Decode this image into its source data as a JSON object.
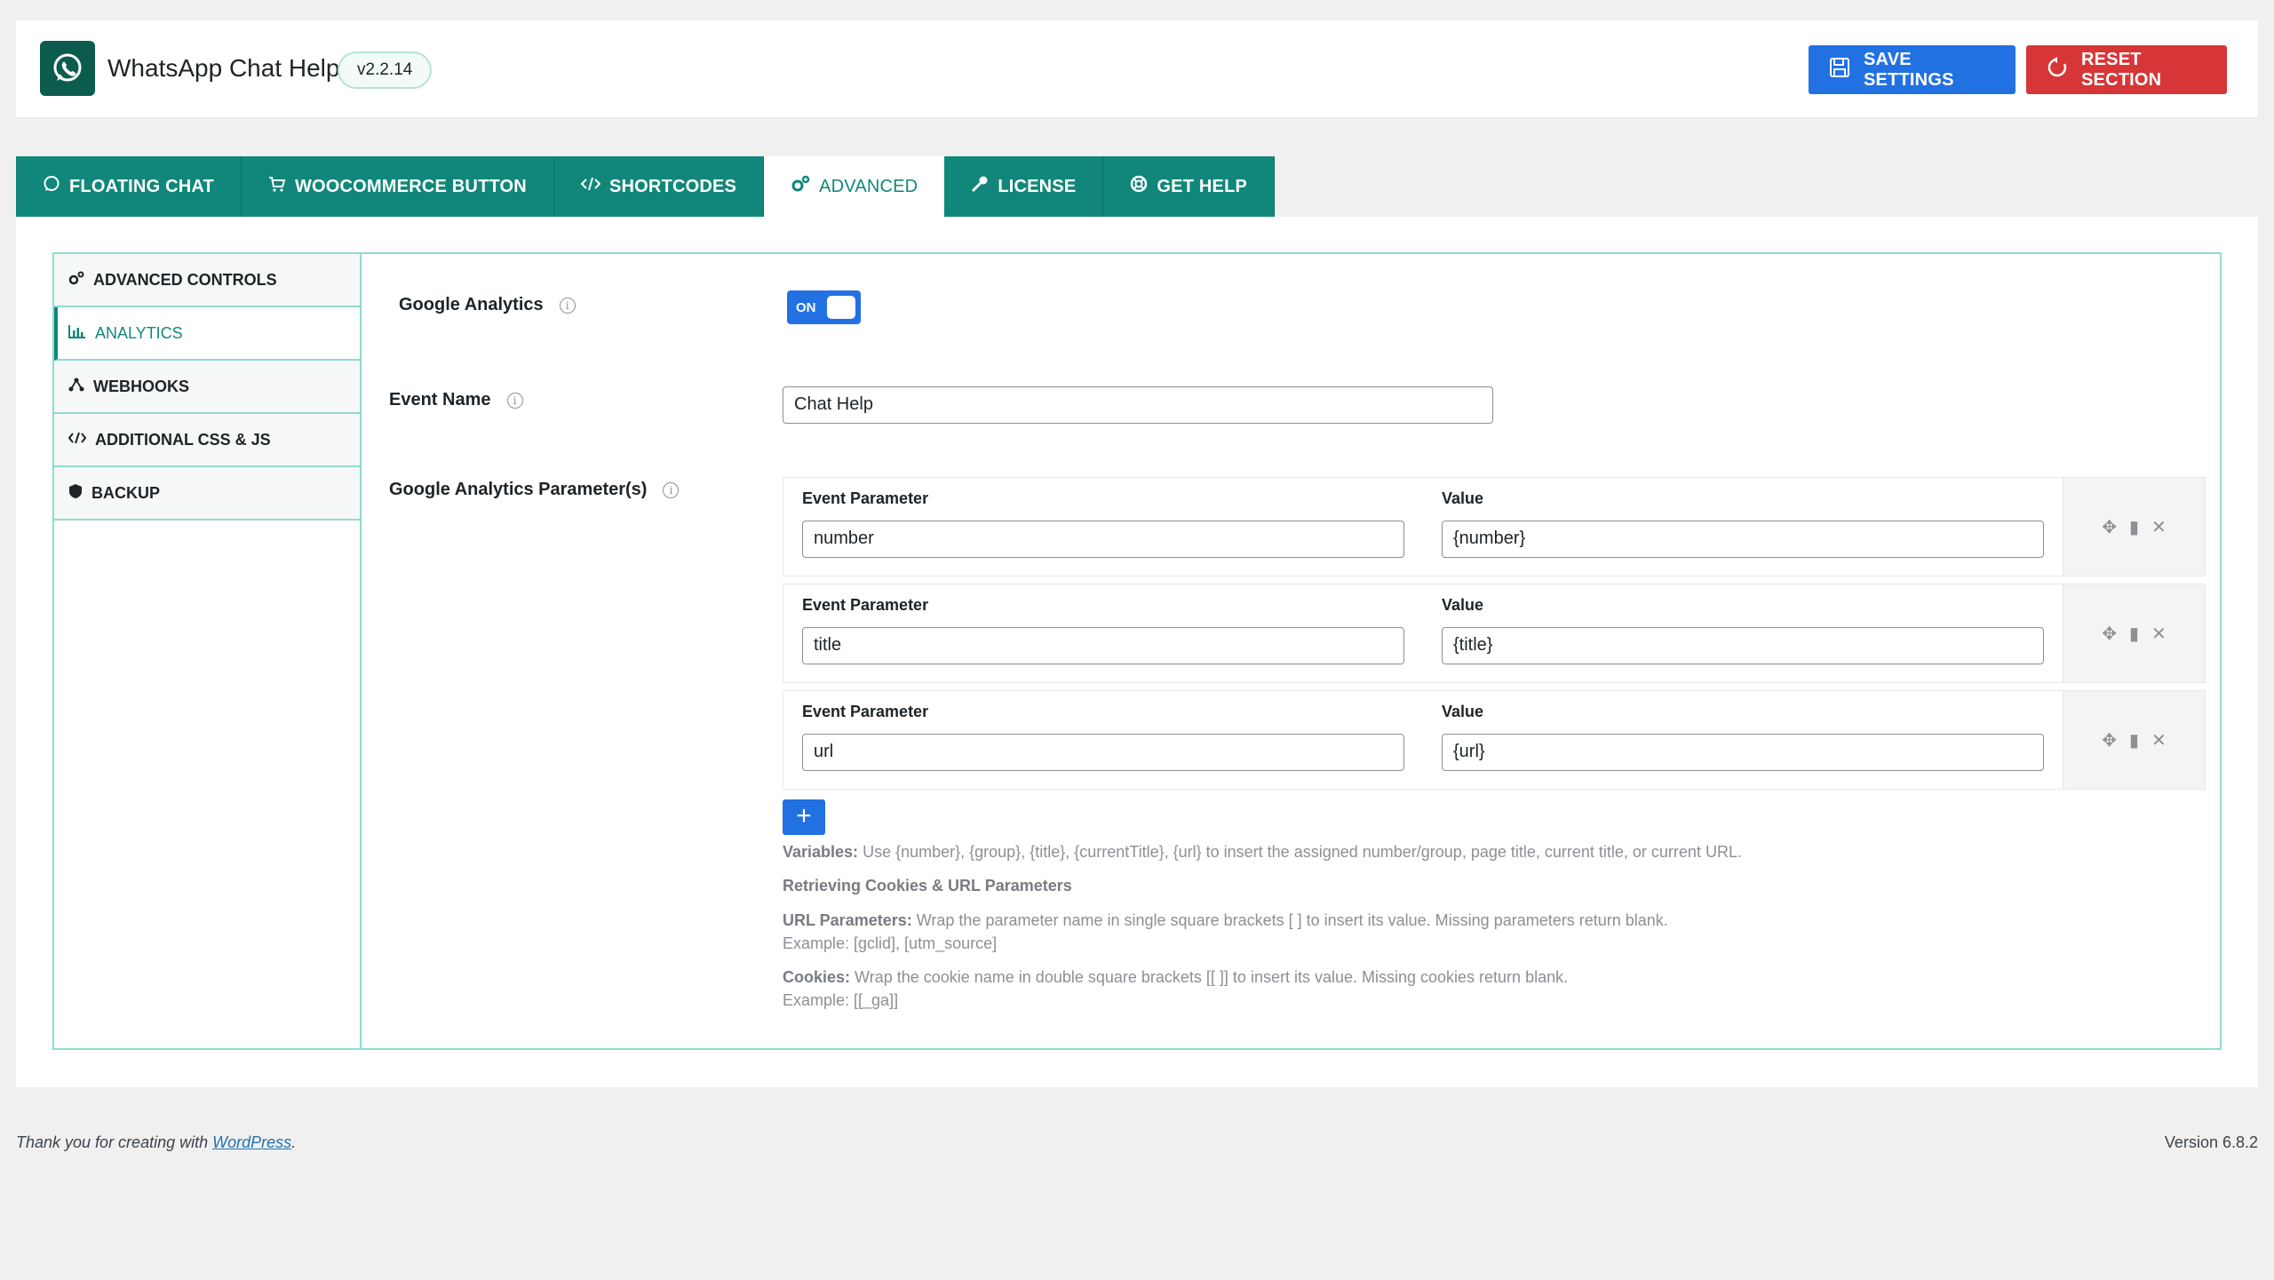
{
  "app": {
    "title": "WhatsApp Chat Help",
    "version": "v2.2.14"
  },
  "header": {
    "save_label": "SAVE SETTINGS",
    "reset_label": "RESET SECTION"
  },
  "tabs": [
    {
      "label": "FLOATING CHAT",
      "icon": "whatsapp-icon"
    },
    {
      "label": "WOOCOMMERCE BUTTON",
      "icon": "cart-icon"
    },
    {
      "label": "SHORTCODES",
      "icon": "code-icon"
    },
    {
      "label": "ADVANCED",
      "icon": "gears-icon",
      "active": true
    },
    {
      "label": "LICENSE",
      "icon": "key-icon"
    },
    {
      "label": "GET HELP",
      "icon": "lifebuoy-icon"
    }
  ],
  "sidebar": {
    "items": [
      {
        "label": "ADVANCED CONTROLS",
        "icon": "gears-icon"
      },
      {
        "label": "ANALYTICS",
        "icon": "chart-icon",
        "active": true
      },
      {
        "label": "WEBHOOKS",
        "icon": "webhook-icon"
      },
      {
        "label": "ADDITIONAL CSS & JS",
        "icon": "code-icon"
      },
      {
        "label": "BACKUP",
        "icon": "shield-icon"
      }
    ]
  },
  "fields": {
    "ga_label": "Google Analytics",
    "ga_toggle": "ON",
    "event_name_label": "Event Name",
    "event_name_value": "Chat Help",
    "params_label": "Google Analytics Parameter(s)",
    "param_header": "Event Parameter",
    "value_header": "Value",
    "params": [
      {
        "param": "number",
        "value": "{number}"
      },
      {
        "param": "title",
        "value": "{title}"
      },
      {
        "param": "url",
        "value": "{url}"
      }
    ],
    "add_label": "+"
  },
  "help": {
    "variables_label": "Variables:",
    "variables_text": " Use {number}, {group}, {title}, {currentTitle}, {url} to insert the assigned number/group, page title, current title, or current URL.",
    "retrieving_heading": "Retrieving Cookies & URL Parameters",
    "url_label": "URL Parameters:",
    "url_text": " Wrap the parameter name in single square brackets [ ] to insert its value. Missing parameters return blank.",
    "url_example": "Example: [gclid], [utm_source]",
    "cookies_label": "Cookies:",
    "cookies_text": " Wrap the cookie name in double square brackets [[ ]] to insert its value. Missing cookies return blank.",
    "cookies_example": "Example: [[_ga]]"
  },
  "footer": {
    "thanks_prefix": "Thank you for creating with ",
    "thanks_link": "WordPress",
    "thanks_suffix": ".",
    "version": "Version 6.8.2"
  },
  "colors": {
    "accent": "#10877a",
    "primary": "#2271e2",
    "danger": "#d63638"
  }
}
